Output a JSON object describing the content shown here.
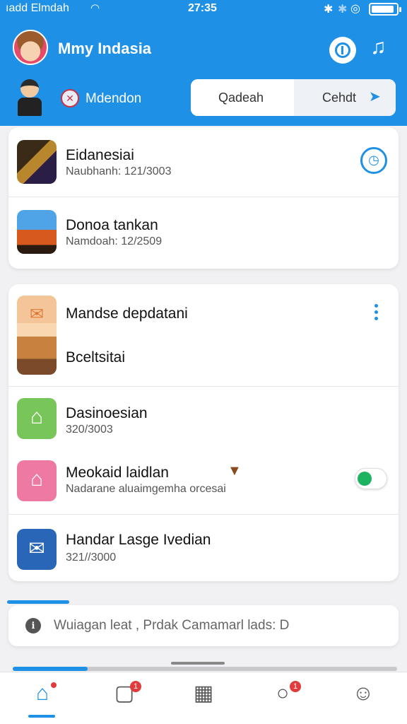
{
  "status_bar": {
    "carrier": "ıadd Elmdah",
    "time": "27:35",
    "battery_level": 0.9
  },
  "header": {
    "title": "Mmy Indasia",
    "subtitle": "Mdendon",
    "segment_left": "Qadeah",
    "segment_right": "Cehdt"
  },
  "card1": {
    "items": [
      {
        "title": "Eidanesiai",
        "subtitle": "Naubhanh: 121/3003"
      },
      {
        "title": "Donoa tankan",
        "subtitle": "Namdoah: 12/2509"
      }
    ]
  },
  "card2": {
    "items": [
      {
        "title": "Mandse depdatani",
        "subtitle": "Bceltsitai"
      },
      {
        "title": "Dasinoesian",
        "subtitle": "320/3003"
      },
      {
        "title": "Meokaid laidlan",
        "subtitle": "Nadarane aluaimgemha orcesai",
        "switch_on": true
      },
      {
        "title": "Handar Lasge Ivedian",
        "subtitle": "321//3000"
      }
    ]
  },
  "search": {
    "text": "Wuiagan leat , Prdak Camamarl lads: D"
  },
  "bottom_nav": {
    "items": [
      {
        "name": "home",
        "icon": "home-icon",
        "badge": ""
      },
      {
        "name": "lock",
        "icon": "lock-icon",
        "badge": "1"
      },
      {
        "name": "calendar",
        "icon": "calendar-icon",
        "badge": ""
      },
      {
        "name": "chat",
        "icon": "chat-icon",
        "badge": "1"
      },
      {
        "name": "profile",
        "icon": "profile-icon",
        "badge": ""
      }
    ]
  },
  "colors": {
    "primary": "#1e90e6",
    "toggle_on": "#1db360",
    "badge": "#e23b3b"
  }
}
